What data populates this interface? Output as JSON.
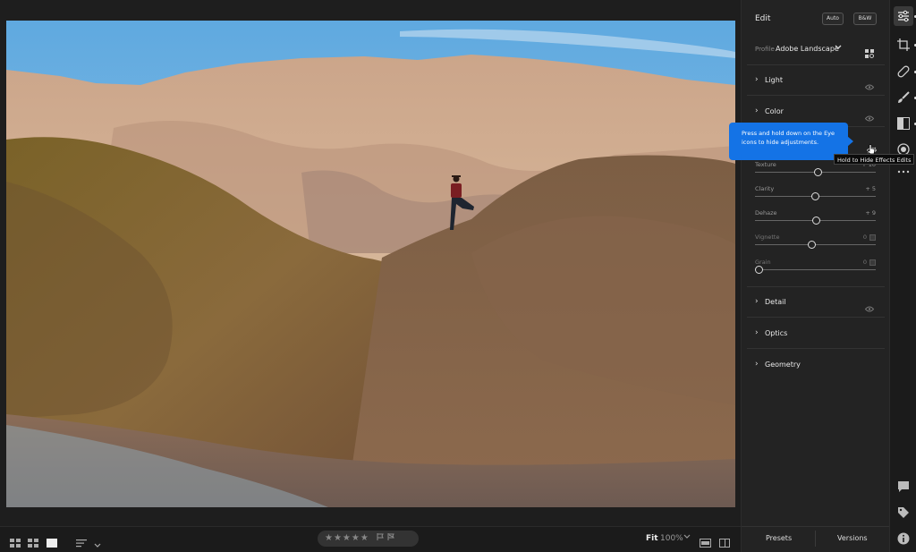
{
  "edit_panel": {
    "title": "Edit",
    "auto_label": "Auto",
    "bw_label": "B&W",
    "profile_label": "Profile",
    "profile_value": "Adobe Landscape",
    "sections": [
      {
        "label": "Light"
      },
      {
        "label": "Color"
      }
    ],
    "effects_sliders": [
      {
        "label": "Texture",
        "value": "+ 10",
        "position": 0.52
      },
      {
        "label": "Clarity",
        "value": "+ 5",
        "position": 0.5
      },
      {
        "label": "Dehaze",
        "value": "+ 9",
        "position": 0.51
      },
      {
        "label": "Vignette",
        "value": "0",
        "position": 0.47
      },
      {
        "label": "Grain",
        "value": "0",
        "position": 0.0
      }
    ],
    "lower_sections": [
      {
        "label": "Detail"
      },
      {
        "label": "Optics"
      },
      {
        "label": "Geometry"
      }
    ],
    "footer": {
      "presets": "Presets",
      "versions": "Versions"
    }
  },
  "tooltips": {
    "coach_mark": "Press and hold down on the Eye icons to hide adjustments.",
    "hover": "Hold to Hide Effects Edits"
  },
  "bottom_bar": {
    "rating_stars": "★★★★★",
    "fit_label": "Fit",
    "zoom_label": "100%"
  },
  "colors": {
    "accent": "#1473e6",
    "panel_bg": "#232323",
    "sky": "#6fb2e0"
  },
  "icons": {
    "toolstrip": [
      "edit-sliders-icon",
      "crop-icon",
      "healing-icon",
      "brush-icon",
      "gradient-icon",
      "radial-icon",
      "more-icon",
      "comment-icon",
      "tag-icon",
      "info-icon"
    ]
  }
}
